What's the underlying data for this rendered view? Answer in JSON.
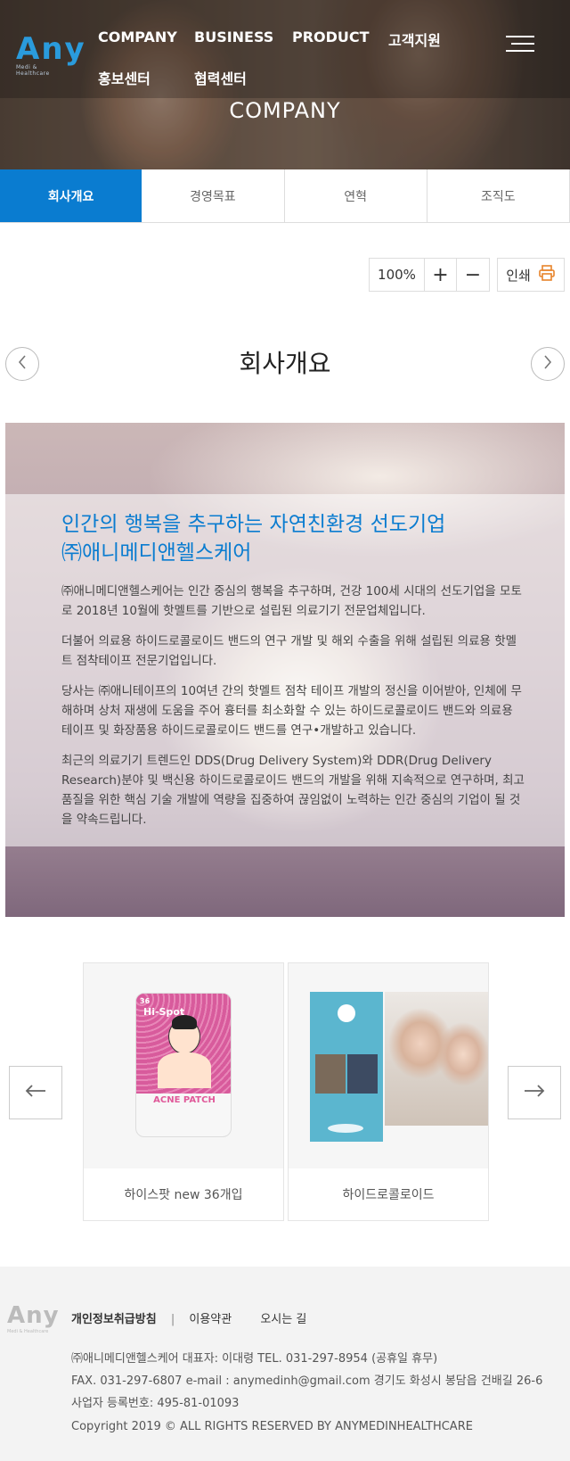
{
  "header": {
    "logo_text": "Any",
    "logo_sub": "Medi & Healthcare",
    "nav": [
      "COMPANY",
      "BUSINESS",
      "PRODUCT",
      "고객지원",
      "홍보센터",
      "협력센터"
    ],
    "section_title": "COMPANY"
  },
  "tabs": [
    {
      "label": "회사개요",
      "active": true
    },
    {
      "label": "경영목표",
      "active": false
    },
    {
      "label": "연혁",
      "active": false
    },
    {
      "label": "조직도",
      "active": false
    }
  ],
  "toolbar": {
    "zoom_value": "100%",
    "zoom_in": "+",
    "zoom_out": "−",
    "print_label": "인쇄"
  },
  "page": {
    "heading": "회사개요"
  },
  "intro": {
    "headline_1": "인간의 행복을 추구하는 자연친환경 선도기업",
    "headline_2": "㈜애니메디앤헬스케어",
    "paragraphs": [
      "㈜애니메디앤헬스케어는 인간 중심의 행복을 추구하며, 건강 100세 시대의 선도기업을 모토로 2018년 10월에 핫멜트를 기반으로 설립된 의료기기 전문업체입니다.",
      "더불어 의료용 하이드로콜로이드 밴드의 연구 개발 및 해외 수출을 위해 설립된 의료용 핫멜트 점착테이프 전문기업입니다.",
      "당사는 ㈜애니테이프의 10여년 간의 핫멜트 점착 테이프 개발의 정신을 이어받아, 인체에 무해하며 상처 재생에 도움을 주어 흉터를 최소화할 수 있는 하이드로콜로이드 밴드와 의료용 테이프 및 화장품용 하이드로콜로이드 밴드를 연구•개발하고 있습니다.",
      "최근의 의료기기 트렌드인 DDS(Drug Delivery System)와 DDR(Drug Delivery Research)분야 및 백신용 하이드로콜로이드 밴드의 개발을 위해 지속적으로 연구하며, 최고 품질을 위한 핵심 기술 개발에 역량을 집중하여 끊임없이 노력하는 인간 중심의 기업이 될 것을 약속드립니다."
    ]
  },
  "products": [
    {
      "caption": "하이스팟 new 36개입",
      "pack_brand": "Hi-Spot",
      "pack_title": "ACNE PATCH",
      "pack_count": "36"
    },
    {
      "caption": "하이드로콜로이드"
    }
  ],
  "footer": {
    "logo_text": "Any",
    "logo_sub": "Medi & Healthcare",
    "link_privacy": "개인정보취급방침",
    "separator": "|",
    "link_terms": "이용약관",
    "link_directions": "오시는 길",
    "line1": "㈜애니메디앤헬스케어     대표자: 이대령     TEL. 031-297-8954 (공휴일 휴무)",
    "line2": "FAX. 031-297-6807     e-mail : anymedinh@gmail.com     경기도 화성시 봉담읍 건배길 26-6",
    "line3": "사업자 등록번호: 495-81-01093",
    "copyright": "Copyright 2019 © ALL RIGHTS RESERVED BY ANYMEDINHEALTHCARE"
  },
  "colors": {
    "accent": "#0a7cd0",
    "footer_bg": "#f3f3f3"
  }
}
